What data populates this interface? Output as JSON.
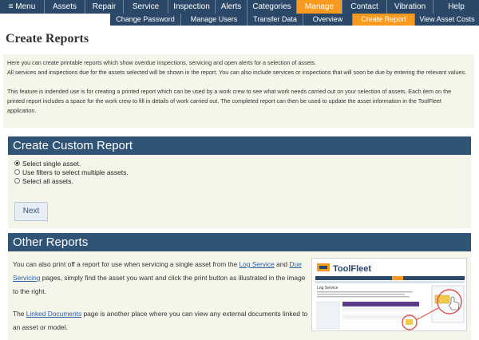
{
  "nav": {
    "items": [
      "≡ Menu",
      "Assets",
      "Repair",
      "Service",
      "Inspection",
      "Alerts",
      "Categories",
      "Manage",
      "Contact",
      "Vibration",
      "Help"
    ],
    "active_index": 7
  },
  "subnav": {
    "items": [
      "Change Password",
      "Manage Users",
      "Transfer Data",
      "Overview",
      "Create Report",
      "View Asset Costs"
    ],
    "active_index": 4
  },
  "page_title": "Create Reports",
  "intro": {
    "line1": "Here you can create printable reports which show overdue inspections, servicing and open alerts for a selection of assets.",
    "line2": "All services and inspections due for the assets selected will be shown in the report.  You can also include services or inspections that will soon be due by entering the relevant values.",
    "line3": "This feature is indended use is for creating a printed report which can be used by a work crew to see what work needs carried out on your selection of assets. Each item on the printed report includes a space for the work crew to fill in details of work carried out.  The completed report can then be used to update the asset information in the ToolFleet application."
  },
  "custom_report": {
    "heading": "Create Custom Report",
    "options": [
      "Select single asset.",
      "Use filters to select multiple assets.",
      "Select all assets."
    ],
    "selected_index": 0,
    "next_label": "Next"
  },
  "other_reports": {
    "heading": "Other Reports",
    "para1_a": "You can also print off a report for use when servicing a single asset from the",
    "link_log_service": "Log Service",
    "and": "and",
    "link_due_servicing": "Due Servicing",
    "para1_b": "pages, simply find the asset you want and click the print button as illustrated in the image to the right.",
    "para2_a": "The",
    "link_linked_documents": "Linked Documents",
    "para2_b": "page is another place where you can view any external documents linked to an asset or model.",
    "thumbnail_brand": "ToolFleet",
    "thumbnail_title": "Log Service"
  },
  "colors": {
    "nav_bg": "#2b4868",
    "active": "#f79a1f",
    "section_head": "#2f5475",
    "panel_bg": "#f6f5ea",
    "link": "#2a5fa5"
  }
}
